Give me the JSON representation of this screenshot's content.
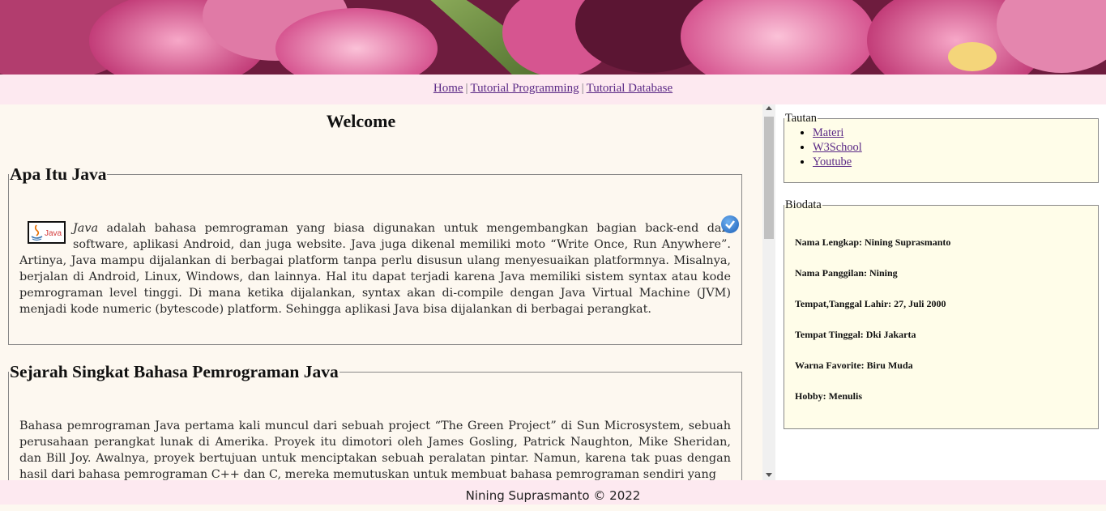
{
  "nav": {
    "links": [
      "Home",
      "Tutorial Programming",
      "Tutorial Database"
    ],
    "separator": "|"
  },
  "main": {
    "title": "Welcome",
    "section1": {
      "heading": "Apa Itu Java",
      "logo_text": "Java",
      "lead_word": "Java",
      "body": " adalah bahasa pemrograman yang biasa digunakan untuk mengembangkan bagian back-end dari software, aplikasi Android, dan juga website. Java juga dikenal memiliki moto “Write Once, Run Anywhere”. Artinya, Java mampu dijalankan di berbagai platform tanpa perlu disusun ulang menyesuaikan platformnya. Misalnya, berjalan di Android, Linux, Windows, dan lainnya. Hal itu dapat terjadi karena Java memiliki sistem syntax atau kode pemrograman level tinggi. Di mana ketika dijalankan, syntax akan di-compile dengan Java Virtual Machine (JVM) menjadi kode numeric (bytescode) platform. Sehingga aplikasi Java bisa dijalankan di berbagai perangkat."
    },
    "section2": {
      "heading": "Sejarah Singkat Bahasa Pemrograman Java",
      "body": "Bahasa pemrograman Java pertama kali muncul dari sebuah project “The Green Project” di Sun Microsystem, sebuah perusahaan perangkat lunak di Amerika. Proyek itu dimotori oleh James Gosling, Patrick Naughton, Mike Sheridan, dan Bill Joy. Awalnya, proyek bertujuan untuk menciptakan sebuah peralatan pintar. Namun, karena tak puas dengan hasil dari bahasa pemrograman C++ dan C, mereka memutuskan untuk membuat bahasa pemrograman sendiri yang"
    }
  },
  "sidebar": {
    "links_title": "Tautan",
    "links": [
      "Materi",
      "W3School",
      "Youtube"
    ],
    "bio_title": "Biodata",
    "bio": [
      "Nama Lengkap: Nining Suprasmanto",
      "Nama Panggilan: Nining",
      "Tempat,Tanggal Lahir: 27, Juli 2000",
      "Tempat Tinggal: Dki Jakarta",
      "Warna Favorite: Biru Muda",
      "Hobby: Menulis"
    ]
  },
  "footer": {
    "text": "Nining Suprasmanto © 2022"
  },
  "colors": {
    "nav_bg": "#fde9f0",
    "content_bg": "#fdf8f0",
    "sidebar_box_bg": "#fffde9",
    "link": "#5b2a86"
  }
}
